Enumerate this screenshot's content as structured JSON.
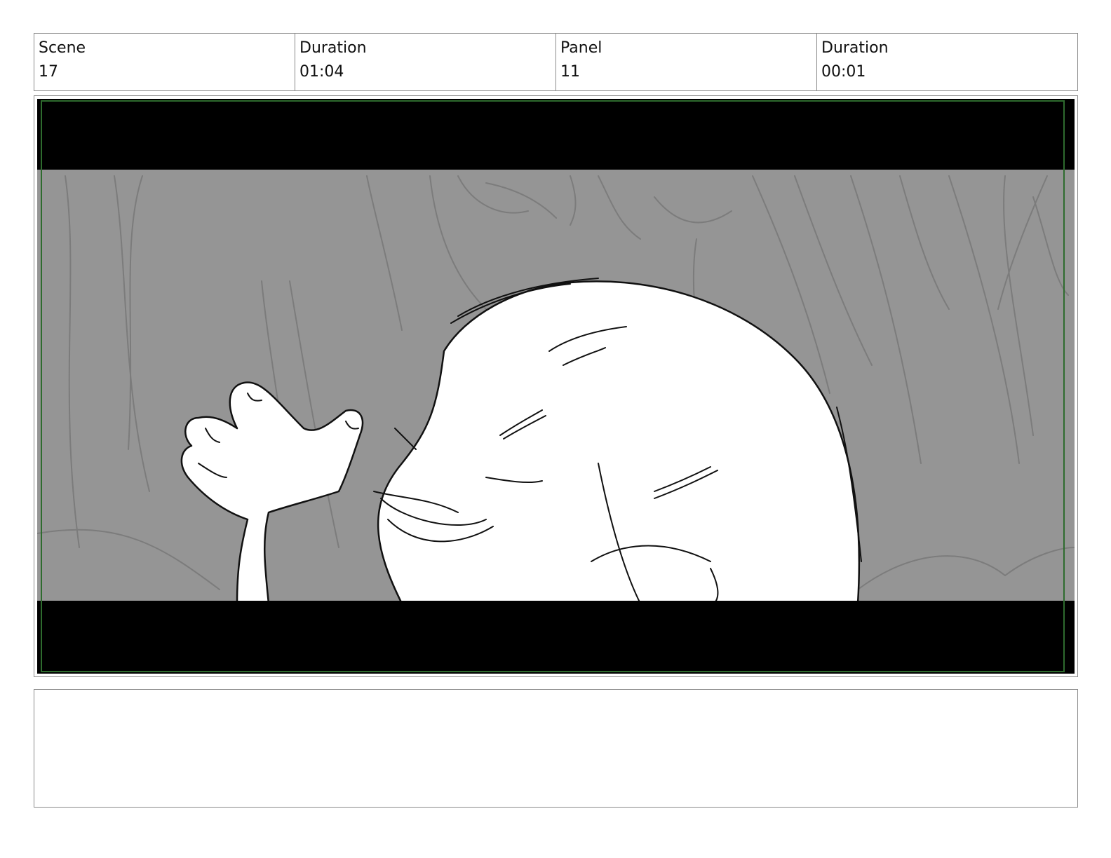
{
  "header": {
    "scene": {
      "label": "Scene",
      "value": "17"
    },
    "scene_duration": {
      "label": "Duration",
      "value": "01:04"
    },
    "panel": {
      "label": "Panel",
      "value": "11"
    },
    "panel_duration": {
      "label": "Duration",
      "value": "00:01"
    }
  },
  "panel_image": {
    "background_color": "#959595",
    "letterbox_color": "#000000",
    "safe_frame_color": "#2e6b2e"
  },
  "notes": {
    "text": ""
  }
}
